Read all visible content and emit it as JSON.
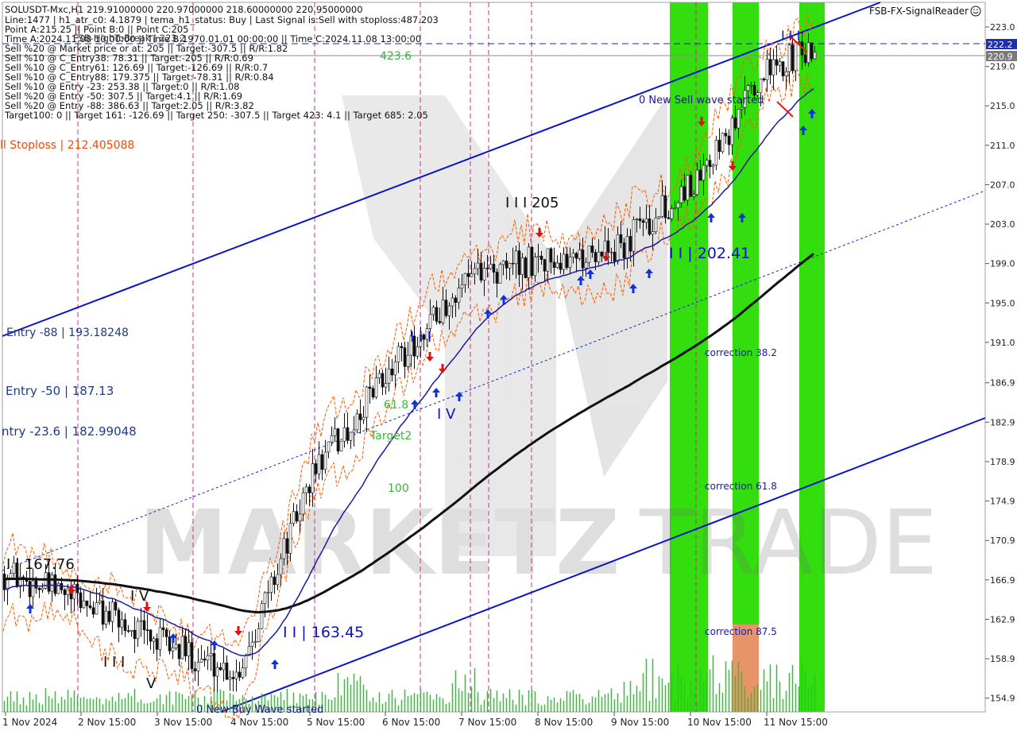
{
  "header": {
    "symbol_line": "SOLUSDT-Mxc,H1  219.91000000 220.97000000 218.60000000 220.95000000",
    "lines": [
      "Line:1477 | h1_atr_c0: 4.1879 | tema_h1_status: Buy | Last Signal is:Sell with stoploss:487.203",
      "Point A:215.25 || Point B:0 || Point C:205",
      "Time A:2024.11.08 10:00:00 || Time B:1970.01.01 00:00:00 || Time C:2024.11.08 13:00:00",
      "Sell %20 @ Market price or at: 205 || Target:-307.5 || R/R:1.82",
      "Sell %10 @ C_Entry38: 78.31 || Target:-205 || R/R:0.69",
      "Sell %10 @ C_Entry61: 126.69 || Target:-126.69 || R/R:0.7",
      "Sell %10 @ C_Entry88: 179.375 || Target:-78.31 || R/R:0.84",
      "Sell %10 @ Entry -23: 253.38 || Target:0 || R/R:1.08",
      "Sell %20 @ Entry -50: 307.5 || Target:4.1 || R/R:1.69",
      "Sell %20 @ Entry -88: 386.63 || Target:2.05 || R/R:3.82",
      "Target100: 0 || Target 161: -126.69 || Target 250: -307.5 || Target 423: 4.1 || Target 685: 2.05"
    ],
    "overlap_text": "FSB-HighToBreak | 223.2",
    "brand": "FSB-FX-SignalReader",
    "brand_icon": "smiley-icon"
  },
  "labels": {
    "stoploss": "ll Stoploss | 212.405088",
    "entry88": "Entry -88 | 193.18248",
    "entry50": "Entry -50 | 187.13",
    "entry23": "ntry -23.6 | 182.99048",
    "target_423": "423.6",
    "target2": "Target2",
    "target_100": "100",
    "target_618": "61.8",
    "new_sell": "0 New Sell wave started",
    "new_buy": "0 New Buy Wave started",
    "corr_382": "correction 38.2",
    "corr_618": "correction 61.8",
    "corr_875": "correction 87.5",
    "wave_205": "I I I 205",
    "wave_20241": "I I | 202.41",
    "wave_16345": "I I | 163.45",
    "wave_16776": "I | 167.76",
    "wave_iii_top": "I I I",
    "wave_iv_mid": "I V",
    "wave_iii_top2": "I I I",
    "wave_iv_left": "I V",
    "wave_iii_left": "I I I",
    "wave_v_left": "V",
    "watermark_a": "MARKETZ",
    "watermark_b": "TRADE"
  },
  "price_axis": {
    "ticks": [
      "223.0",
      "219.0",
      "215.0",
      "211.0",
      "207.0",
      "203.0",
      "199.0",
      "195.0",
      "191.0",
      "186.9",
      "182.9",
      "178.9",
      "174.9",
      "170.9",
      "166.9",
      "162.9",
      "158.9",
      "154.9"
    ],
    "badge_blue": "222.2",
    "badge_gray": "220.9"
  },
  "time_axis": {
    "ticks": [
      "1 Nov 2024",
      "2 Nov 15:00",
      "3 Nov 15:00",
      "4 Nov 15:00",
      "5 Nov 15:00",
      "6 Nov 15:00",
      "7 Nov 15:00",
      "8 Nov 15:00",
      "9 Nov 15:00",
      "10 Nov 15:00",
      "11 Nov 15:00"
    ]
  },
  "colors": {
    "blue_line": "#0a14c8",
    "sma": "#111111",
    "green_zone": "#33dd0e",
    "orange_zone": "#e8946a",
    "sell_arrow": "#e01010",
    "buy_arrow": "#1030e0",
    "orange_text": "#ff4500",
    "target_text": "#3cb43c",
    "envelope": "#ff5a00",
    "magenta": "#c0308a"
  },
  "chart_data": {
    "type": "candlestick",
    "ylim": [
      153.5,
      225.5
    ],
    "key_levels": [
      222.2,
      220.9,
      212.405088,
      193.18248,
      187.13,
      182.99048
    ],
    "close_path": [
      [
        "1 Nov 2024",
        167.5
      ],
      [
        "2 Nov 15:00",
        164.5
      ],
      [
        "3 Nov 15:00",
        160.5
      ],
      [
        "4 Nov 15:00",
        157.5
      ],
      [
        "5 Nov 15:00",
        178.0
      ],
      [
        "6 Nov 15:00",
        188.0
      ],
      [
        "7 Nov 15:00",
        197.5
      ],
      [
        "8 Nov 15:00",
        199.5
      ],
      [
        "9 Nov 15:00",
        200.5
      ],
      [
        "10 Nov 15:00",
        207.5
      ],
      [
        "11 Nov 15:00",
        219.0
      ],
      [
        "last",
        220.95
      ]
    ]
  }
}
